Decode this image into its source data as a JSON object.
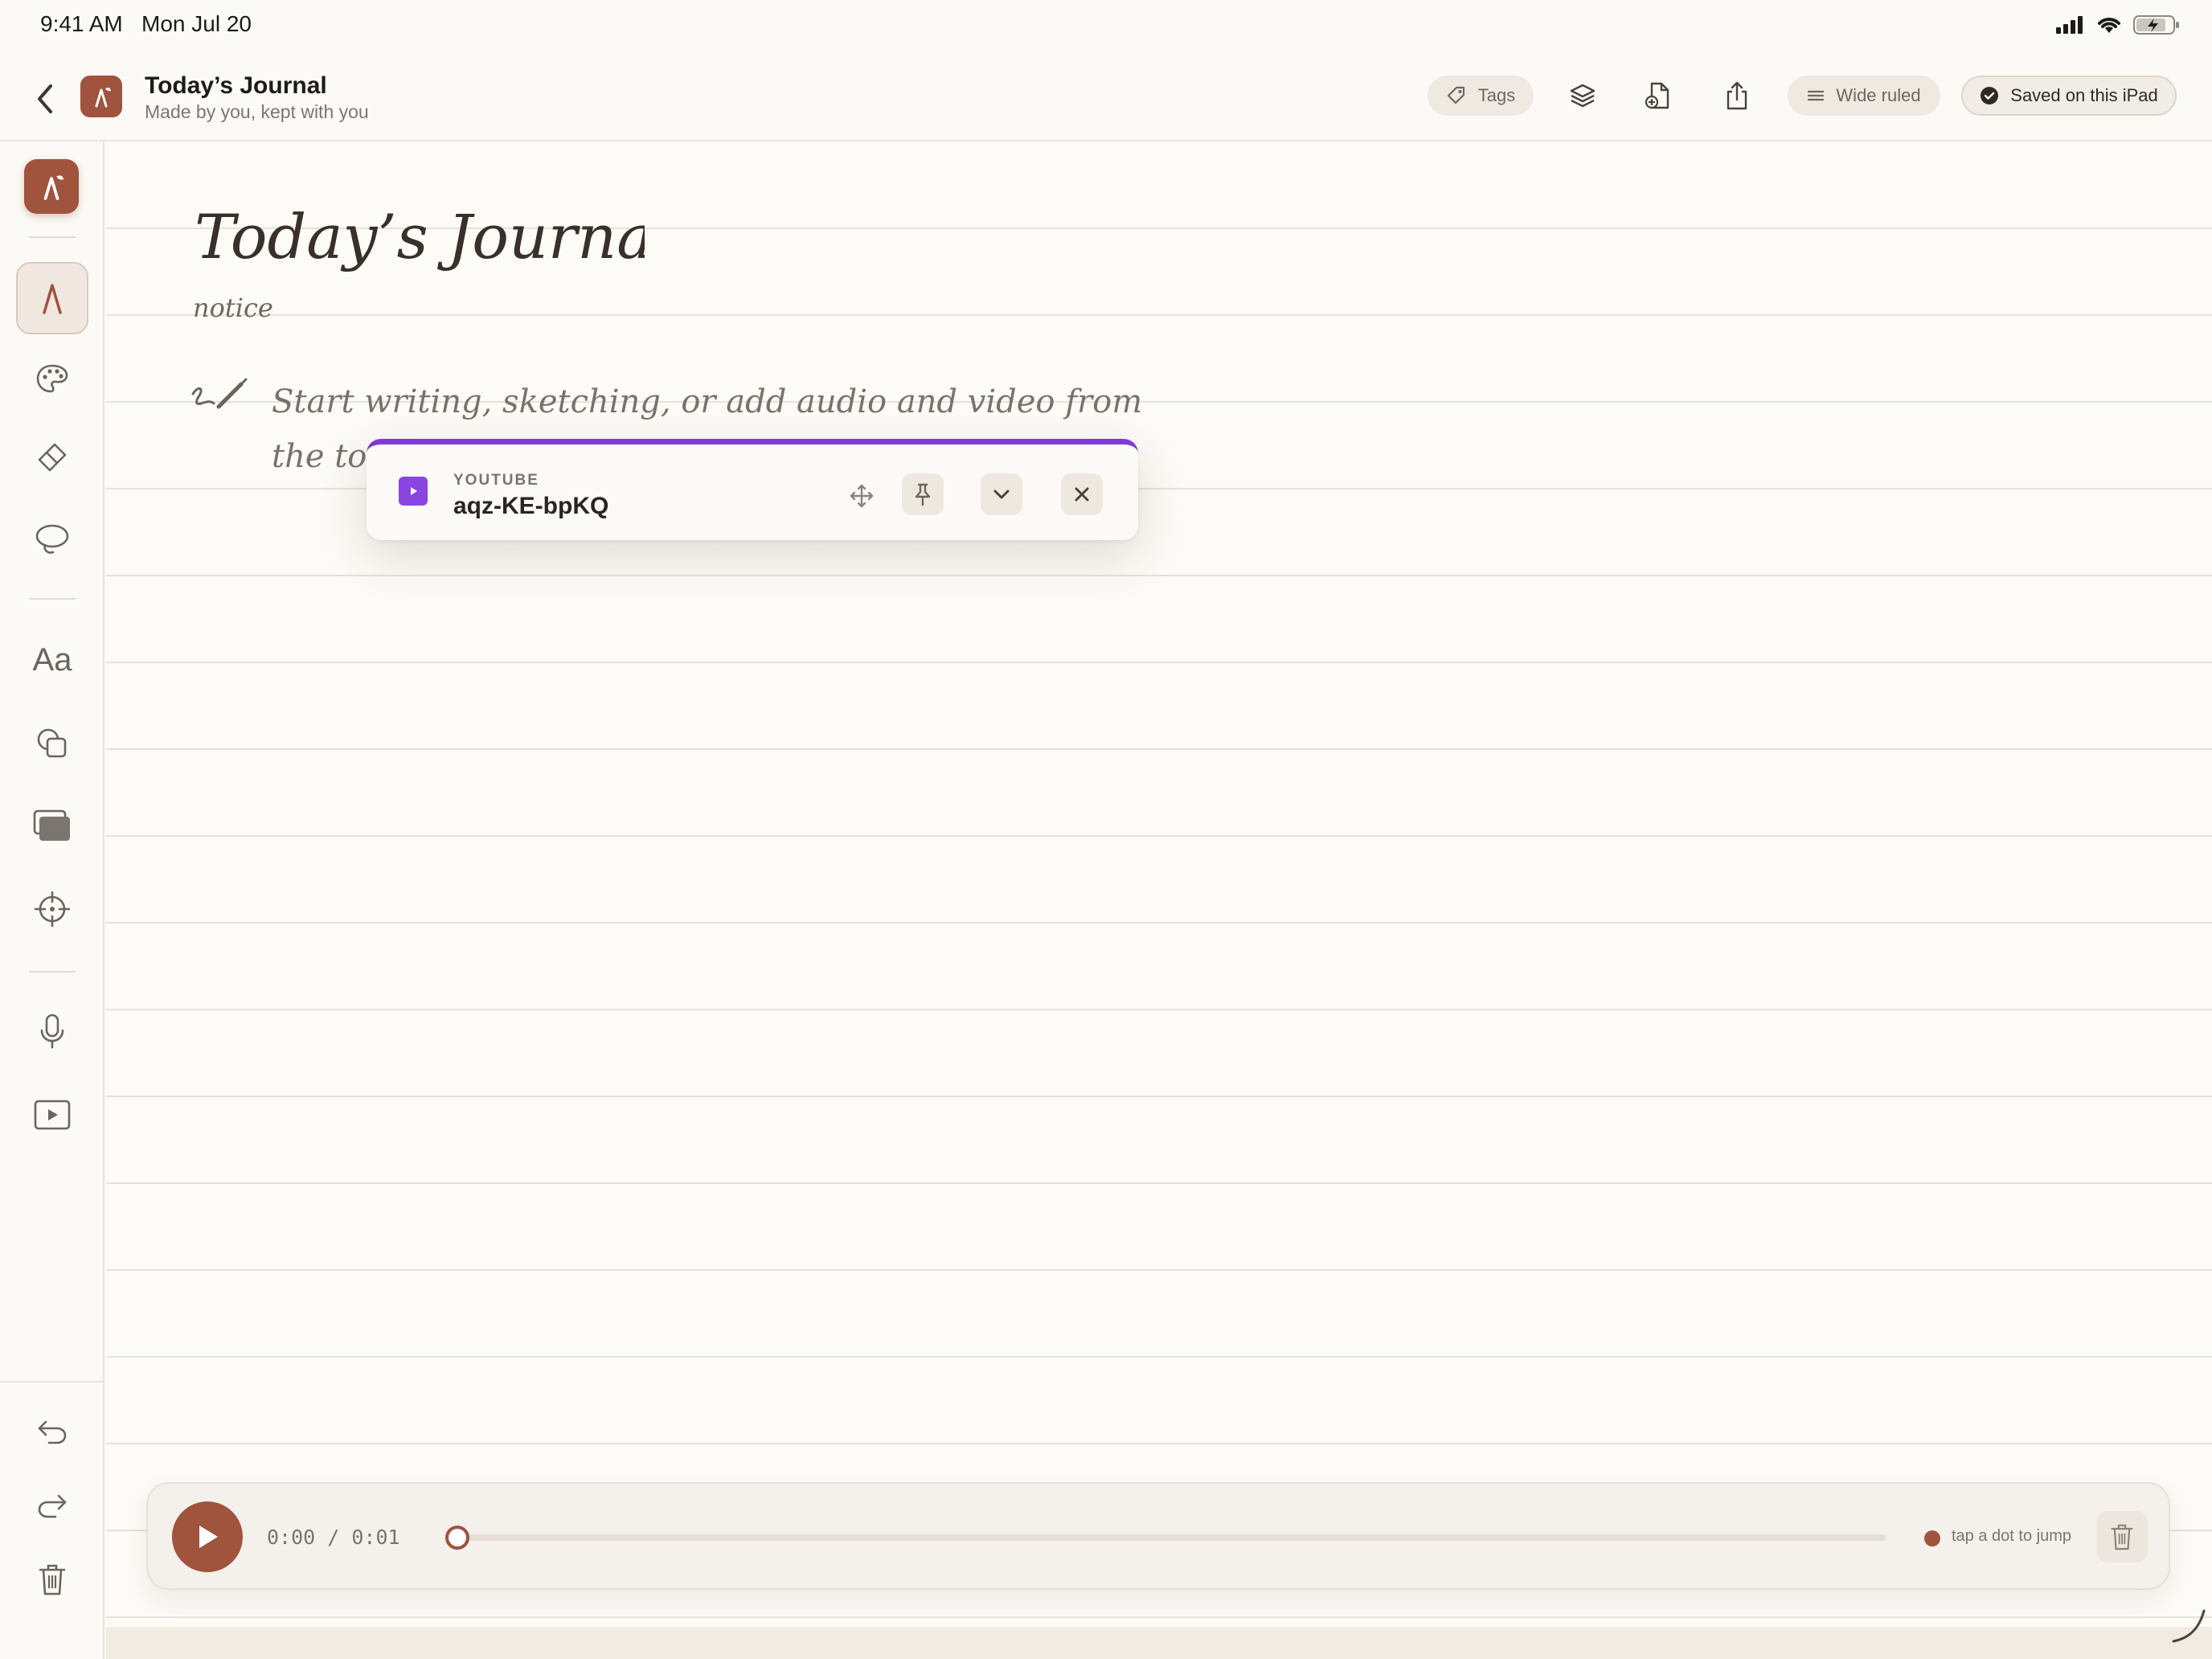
{
  "status_bar": {
    "time": "9:41 AM",
    "date": "Mon Jul 20",
    "icons": [
      "signal-icon",
      "wifi-icon",
      "battery-icon"
    ]
  },
  "header": {
    "title": "Today’s Journal",
    "subtitle": "Made by you, kept with you",
    "tags_label": "Tags",
    "paper_style_label": "Wide ruled",
    "save_status": "Saved on this iPad",
    "icons": [
      "back-icon",
      "app-logo-icon",
      "tag-icon",
      "layers-icon",
      "add-page-icon",
      "share-icon",
      "lines-icon",
      "check-circle-icon"
    ]
  },
  "toolbar": {
    "text_tool_label": "Aa",
    "tools": [
      "pen-icon",
      "palette-icon",
      "eraser-icon",
      "lasso-icon",
      "text-icon",
      "shapes-icon",
      "stickers-icon",
      "target-icon",
      "microphone-icon",
      "video-icon"
    ],
    "bottom_tools": [
      "undo-icon",
      "redo-icon",
      "trash-icon"
    ]
  },
  "page": {
    "title": "Today’s Journal",
    "subtitle": "notice",
    "hint": "Start writing, sketching, or add audio and video from the toolbar."
  },
  "video_card": {
    "source": "YOUTUBE",
    "video_id": "aqz-KE-bpKQ",
    "accent": "#7f3ad8",
    "icons": [
      "play-square-icon",
      "move-icon",
      "pin-icon",
      "chevron-down-icon",
      "close-icon"
    ]
  },
  "audio_player": {
    "time_display": "0:00 / 0:01",
    "progress": 0,
    "jump_hint": "tap a dot to jump",
    "accent": "#a0533d"
  },
  "colors": {
    "brand": "#a0533d",
    "paper": "#fdfbf7",
    "rule_line": "#e6e1da"
  }
}
